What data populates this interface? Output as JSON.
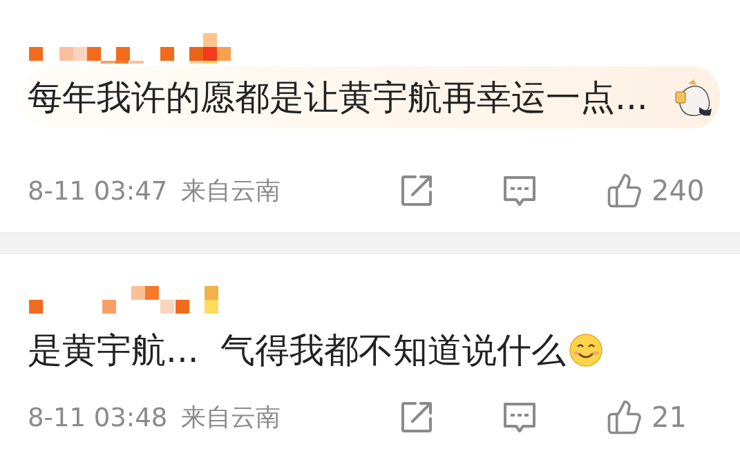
{
  "comments": [
    {
      "kind": "sticker_bubble",
      "text": "每年我许的愿都是让黄宇航再幸运一点...",
      "time": "8-11 03:47",
      "location": "来自云南",
      "like_count": "240"
    },
    {
      "kind": "emoji_end",
      "text": "是黄宇航...  气得我都不知道说什么",
      "time": "8-11 03:48",
      "location": "来自云南",
      "like_count": "21"
    }
  ]
}
